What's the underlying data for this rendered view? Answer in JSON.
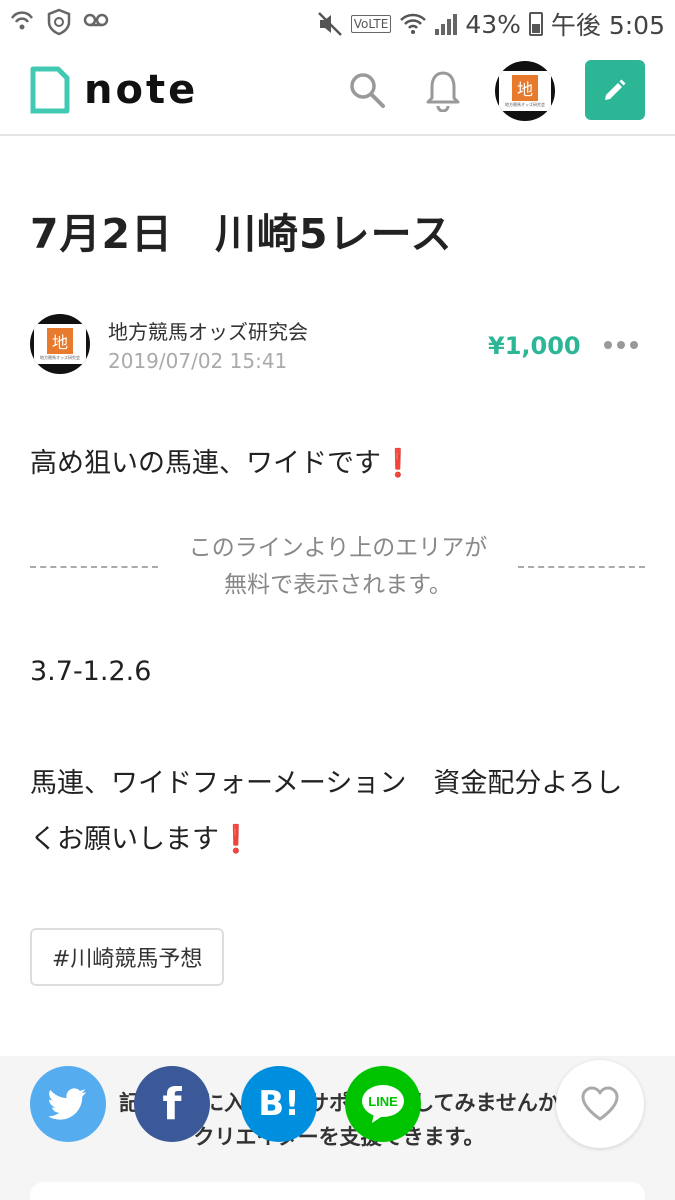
{
  "status_bar": {
    "left_icons": [
      "wifi-call-icon",
      "shield-icon",
      "voicemail-icon"
    ],
    "volte": "VoLTE",
    "battery": "43%",
    "time": "午後 5:05"
  },
  "header": {
    "logo_text": "note",
    "icons": [
      "search-icon",
      "bell-icon",
      "pencil-icon"
    ],
    "avatar_char": "地",
    "accent_color": "#2cb696"
  },
  "article": {
    "title": "7月2日　川崎5レース",
    "author": "地方競馬オッズ研究会",
    "date": "2019/07/02 15:41",
    "price": "¥1,000",
    "para1": "高め狙いの馬連、ワイドです",
    "free_notice_line1": "このラインより上のエリアが",
    "free_notice_line2": "無料で表示されます。",
    "para2": "3.7-1.2.6",
    "para3": "馬連、ワイドフォーメーション　資金配分よろしくお願いします",
    "exclamation": "❗",
    "hashtag": "#川崎競馬予想"
  },
  "support": {
    "line1": "記事が気に入ったらサポートをしてみませんか",
    "line2": "クリエイターを支援できます。"
  }
}
